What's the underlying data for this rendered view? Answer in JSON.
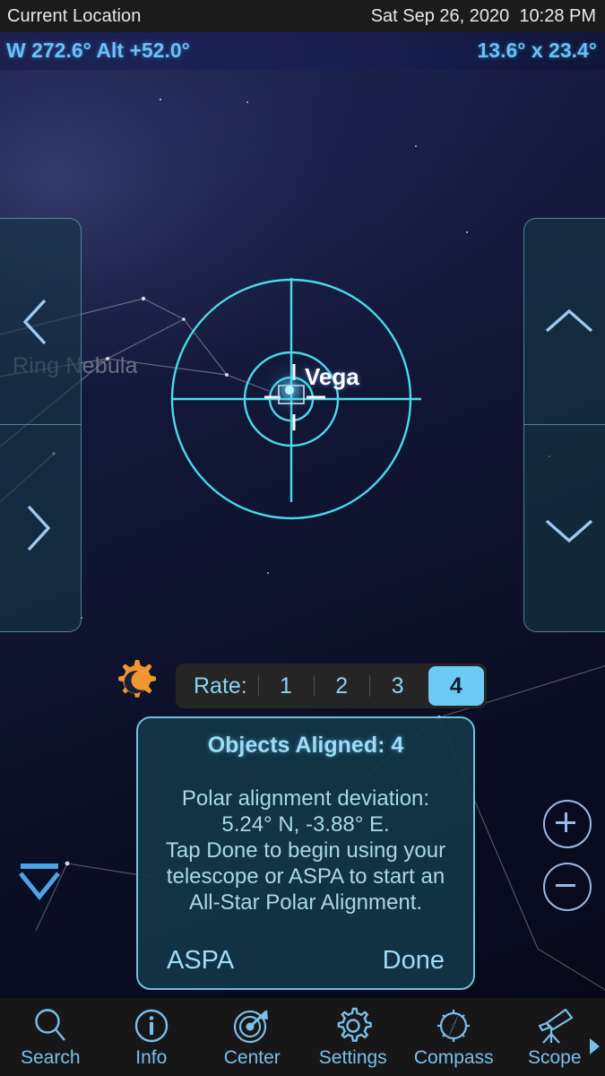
{
  "topbar": {
    "location": "Current Location",
    "datetime": "Sat Sep 26, 2020  10:28 PM"
  },
  "coordbar": {
    "pointing": "W 272.6° Alt +52.0°",
    "field_of_view": "13.6° x 23.4°",
    "color": "#67c2f5"
  },
  "sky": {
    "labels": [
      {
        "name": "ring-nebula",
        "text": "Ring Nebula"
      }
    ],
    "target": {
      "name": "Vega",
      "label": "Vega"
    }
  },
  "dpad": {
    "left_top_icon": "chevron-left-icon",
    "left_bottom_icon": "chevron-right-icon",
    "right_top_icon": "chevron-up-icon",
    "right_bottom_icon": "chevron-down-icon"
  },
  "rate": {
    "gear_icon": "gear-moon-icon",
    "gear_color": "#f0962e",
    "label": "Rate:",
    "options": [
      "1",
      "2",
      "3",
      "4"
    ],
    "selected": "4",
    "selected_color": "#6ccbf5"
  },
  "dialog": {
    "title": "Objects Aligned: 4",
    "body_line1": "Polar alignment deviation:",
    "body_line2": "5.24° N, -3.88° E.",
    "body_line3": "Tap Done to begin using your",
    "body_line4": "telescope or ASPA to start an",
    "body_line5": "All-Star Polar Alignment.",
    "button_left": "ASPA",
    "button_right": "Done",
    "border_color": "#74bedd"
  },
  "zoom_controls": {
    "plus": "plus-circle-icon",
    "minus": "minus-circle-icon"
  },
  "collapse": {
    "icon": "collapse-down-icon"
  },
  "tabbar": {
    "items": [
      {
        "label": "Search",
        "icon": "search-icon"
      },
      {
        "label": "Info",
        "icon": "info-circle-icon"
      },
      {
        "label": "Center",
        "icon": "center-target-icon"
      },
      {
        "label": "Settings",
        "icon": "gear-icon"
      },
      {
        "label": "Compass",
        "icon": "compass-off-icon"
      },
      {
        "label": "Scope",
        "icon": "telescope-icon"
      }
    ],
    "more_icon": "chevron-right-icon",
    "accent_color": "#79c0ea"
  }
}
